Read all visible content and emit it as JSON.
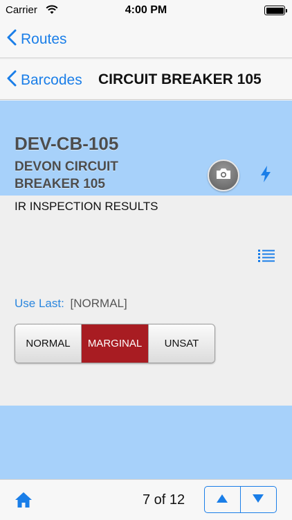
{
  "status_bar": {
    "carrier": "Carrier",
    "time": "4:00 PM",
    "battery_level": 1.0
  },
  "nav": {
    "back_routes_label": "Routes",
    "back_barcodes_label": "Barcodes",
    "title": "CIRCUIT BREAKER 105"
  },
  "asset": {
    "id": "DEV-CB-105",
    "name_line1": "DEVON CIRCUIT",
    "name_line2": "BREAKER 105",
    "camera_icon": "camera-icon",
    "flash_icon": "lightning-icon"
  },
  "inspection": {
    "question": "IR INSPECTION RESULTS",
    "list_icon": "list-icon",
    "use_last_label": "Use Last:",
    "use_last_value": "[NORMAL]",
    "options": [
      "NORMAL",
      "MARGINAL",
      "UNSAT"
    ],
    "selected_option": "MARGINAL"
  },
  "toolbar": {
    "home_icon": "home-icon",
    "page_counter": "7 of 12",
    "prev_icon": "arrow-up-icon",
    "next_icon": "arrow-down-icon"
  },
  "colors": {
    "accent": "#1a7ee8",
    "header_bg": "#a7d1fa",
    "selected_segment": "#a81c22",
    "use_last_label": "#2a86de"
  }
}
